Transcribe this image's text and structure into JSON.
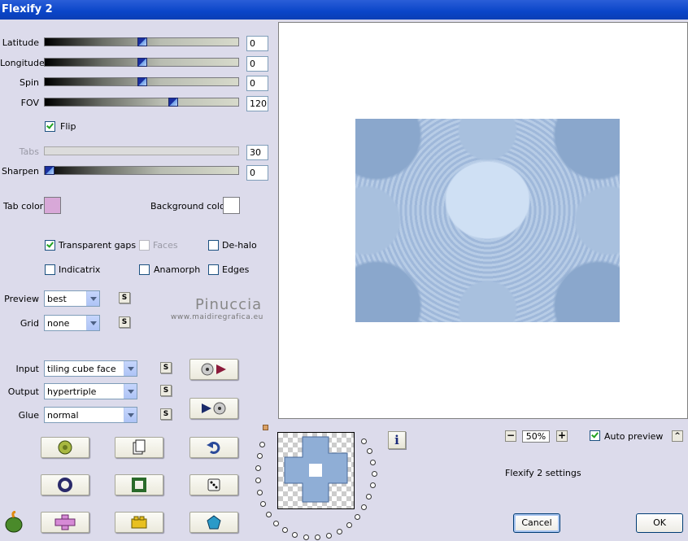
{
  "window": {
    "title": "Flexify 2"
  },
  "sliders": [
    {
      "label": "Latitude",
      "value": "0",
      "pos": 0.5
    },
    {
      "label": "Longitude",
      "value": "0",
      "pos": 0.5
    },
    {
      "label": "Spin",
      "value": "0",
      "pos": 0.5
    },
    {
      "label": "FOV",
      "value": "120",
      "pos": 0.66
    }
  ],
  "flip": {
    "label": "Flip",
    "checked": true
  },
  "tabs": {
    "label": "Tabs",
    "value": "30"
  },
  "sharpen": {
    "label": "Sharpen",
    "value": "0",
    "pos": 0.0
  },
  "colors": {
    "tab_label": "Tab color",
    "tab_color": "#d8a8d8",
    "bg_label": "Background color",
    "bg_color": "#ffffff"
  },
  "options": {
    "transparent_gaps": "Transparent gaps",
    "faces": "Faces",
    "de_halo": "De-halo",
    "indicatrix": "Indicatrix",
    "anamorph": "Anamorph",
    "edges": "Edges"
  },
  "preview": {
    "label": "Preview",
    "value": "best"
  },
  "grid": {
    "label": "Grid",
    "value": "none"
  },
  "input": {
    "label": "Input",
    "value": "tiling cube face"
  },
  "output": {
    "label": "Output",
    "value": "hypertriple"
  },
  "glue": {
    "label": "Glue",
    "value": "normal"
  },
  "s_label": "S",
  "watermark": {
    "name": "Pinuccia",
    "url": "www.maidiregrafica.eu"
  },
  "zoom": {
    "value": "50%",
    "minus": "−",
    "plus": "+"
  },
  "auto_preview": {
    "label": "Auto preview",
    "checked": true
  },
  "settings_text": "Flexify 2 settings",
  "info_label": "i",
  "collapse_label": "^",
  "buttons": {
    "cancel": "Cancel",
    "ok": "OK"
  }
}
